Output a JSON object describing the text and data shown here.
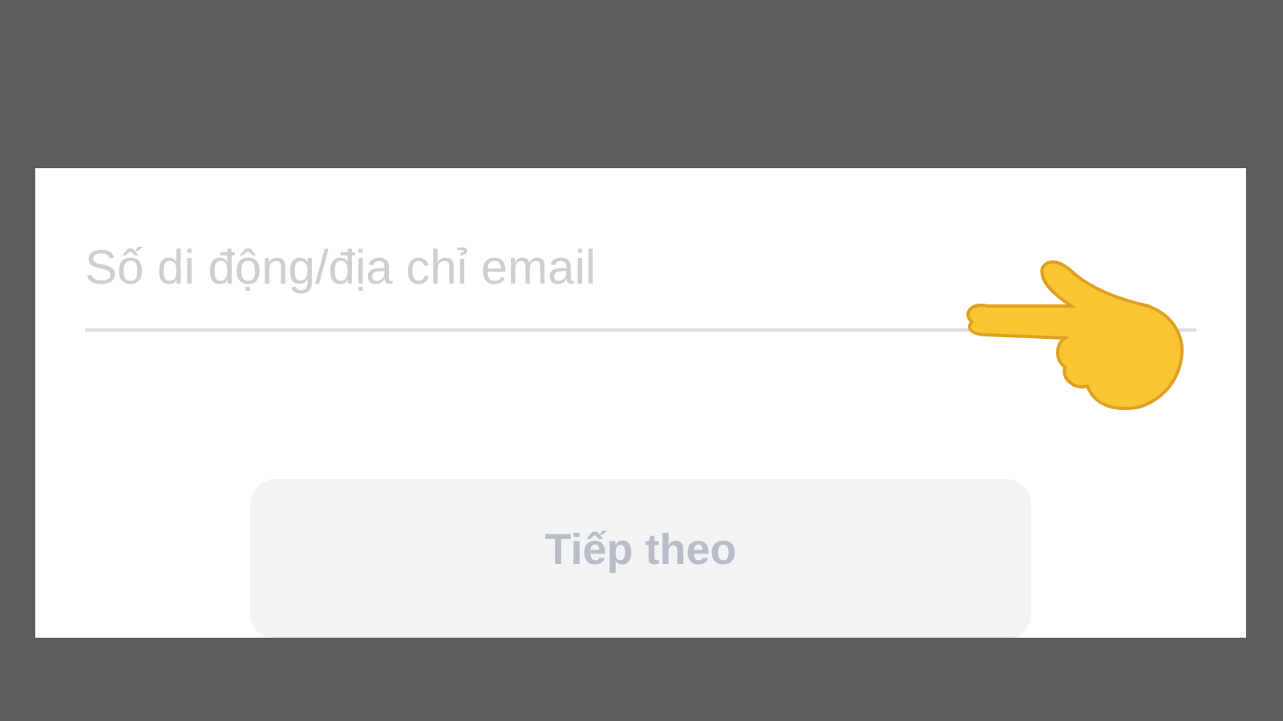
{
  "login": {
    "field": {
      "placeholder": "Số di động/địa chỉ email"
    },
    "next_button": {
      "label": "Tiếp theo",
      "disabled": true
    }
  }
}
